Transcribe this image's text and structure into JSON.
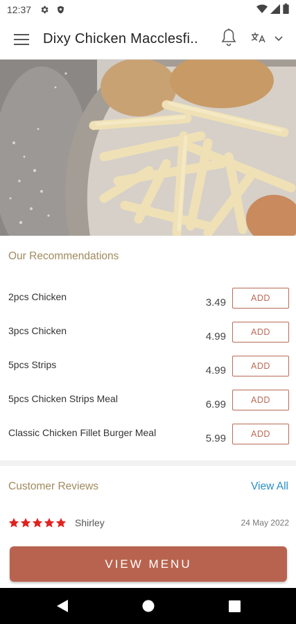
{
  "status_bar": {
    "time": "12:37"
  },
  "app_bar": {
    "title": "Dixy Chicken Macclesfi.."
  },
  "recommendations": {
    "title": "Our Recommendations",
    "add_label": "ADD",
    "items": [
      {
        "name": "2pcs Chicken",
        "price": "3.49"
      },
      {
        "name": "3pcs Chicken",
        "price": "4.99"
      },
      {
        "name": "5pcs Strips",
        "price": "4.99"
      },
      {
        "name": "5pcs Chicken Strips Meal",
        "price": "6.99"
      },
      {
        "name": "Classic Chicken Fillet Burger Meal",
        "price": "5.99"
      }
    ]
  },
  "reviews": {
    "title": "Customer Reviews",
    "view_all": "View All",
    "items": [
      {
        "rating": 5,
        "name": "Shirley",
        "date": "24 May 2022"
      }
    ]
  },
  "cta": {
    "label": "VIEW MENU"
  },
  "colors": {
    "accent": "#b8634f",
    "section_title": "#a08a5e",
    "link": "#2a8fc7",
    "star": "#e0221f"
  },
  "icons": [
    "settings-icon",
    "shield-icon",
    "wifi-icon",
    "signal-icon",
    "battery-icon",
    "hamburger-menu-icon",
    "bell-icon",
    "language-icon",
    "chevron-down-icon",
    "back-icon",
    "home-icon",
    "recents-icon"
  ]
}
